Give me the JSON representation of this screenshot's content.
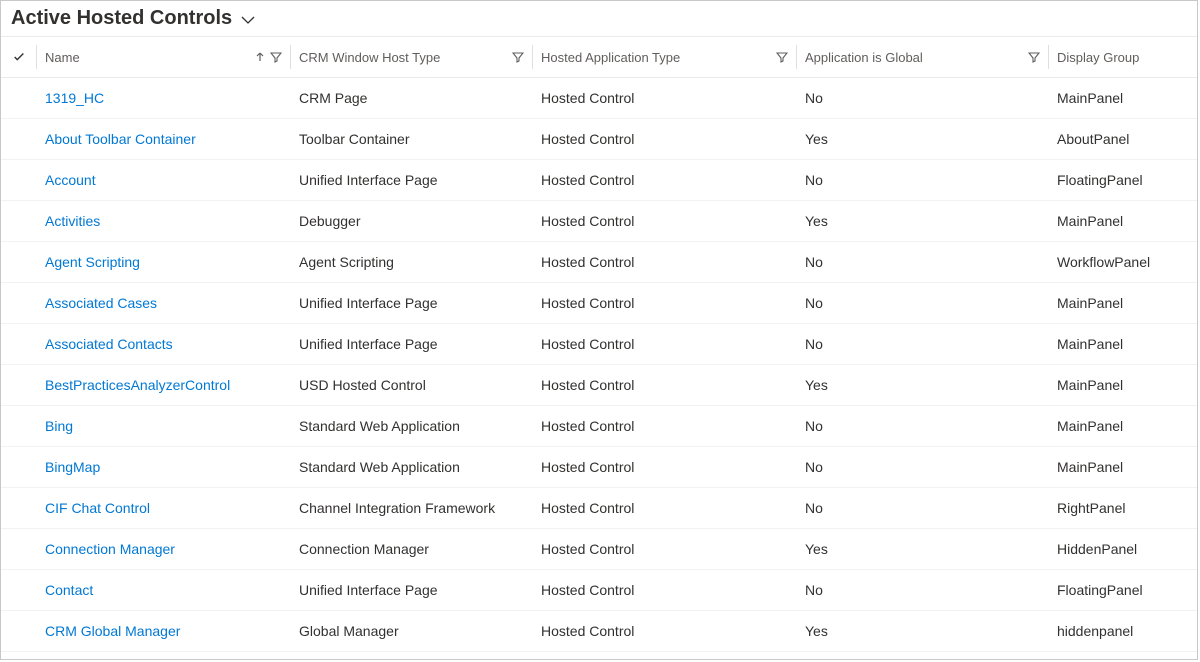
{
  "viewTitle": "Active Hosted Controls",
  "columns": {
    "name": {
      "label": "Name",
      "filterable": true,
      "sortAsc": true
    },
    "type": {
      "label": "CRM Window Host Type",
      "filterable": true
    },
    "app": {
      "label": "Hosted Application Type",
      "filterable": true
    },
    "global": {
      "label": "Application is Global",
      "filterable": true
    },
    "display": {
      "label": "Display Group"
    }
  },
  "rows": [
    {
      "name": "1319_HC",
      "type": "CRM Page",
      "app": "Hosted Control",
      "global": "No",
      "display": "MainPanel"
    },
    {
      "name": "About Toolbar Container",
      "type": "Toolbar Container",
      "app": "Hosted Control",
      "global": "Yes",
      "display": "AboutPanel"
    },
    {
      "name": "Account",
      "type": "Unified Interface Page",
      "app": "Hosted Control",
      "global": "No",
      "display": "FloatingPanel"
    },
    {
      "name": "Activities",
      "type": "Debugger",
      "app": "Hosted Control",
      "global": "Yes",
      "display": "MainPanel"
    },
    {
      "name": "Agent Scripting",
      "type": "Agent Scripting",
      "app": "Hosted Control",
      "global": "No",
      "display": "WorkflowPanel"
    },
    {
      "name": "Associated Cases",
      "type": "Unified Interface Page",
      "app": "Hosted Control",
      "global": "No",
      "display": "MainPanel"
    },
    {
      "name": "Associated Contacts",
      "type": "Unified Interface Page",
      "app": "Hosted Control",
      "global": "No",
      "display": "MainPanel"
    },
    {
      "name": "BestPracticesAnalyzerControl",
      "type": "USD Hosted Control",
      "app": "Hosted Control",
      "global": "Yes",
      "display": "MainPanel"
    },
    {
      "name": "Bing",
      "type": "Standard Web Application",
      "app": "Hosted Control",
      "global": "No",
      "display": "MainPanel"
    },
    {
      "name": "BingMap",
      "type": "Standard Web Application",
      "app": "Hosted Control",
      "global": "No",
      "display": "MainPanel"
    },
    {
      "name": "CIF Chat Control",
      "type": "Channel Integration Framework",
      "app": "Hosted Control",
      "global": "No",
      "display": "RightPanel"
    },
    {
      "name": "Connection Manager",
      "type": "Connection Manager",
      "app": "Hosted Control",
      "global": "Yes",
      "display": "HiddenPanel"
    },
    {
      "name": "Contact",
      "type": "Unified Interface Page",
      "app": "Hosted Control",
      "global": "No",
      "display": "FloatingPanel"
    },
    {
      "name": "CRM Global Manager",
      "type": "Global Manager",
      "app": "Hosted Control",
      "global": "Yes",
      "display": "hiddenpanel"
    }
  ]
}
